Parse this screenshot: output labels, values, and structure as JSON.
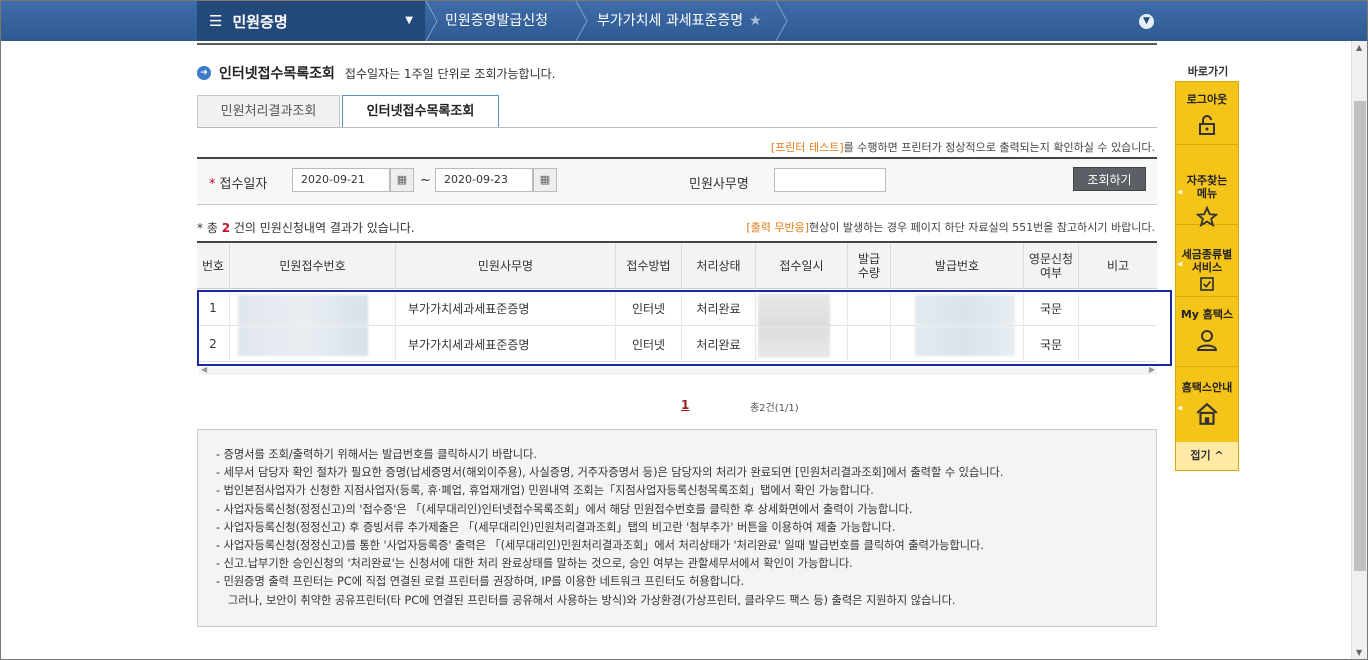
{
  "header": {
    "menu_title": "민원증명",
    "breadcrumb1": "민원증명발급신청",
    "breadcrumb2": "부가가치세 과세표준증명"
  },
  "page": {
    "title": "인터넷접수목록조회",
    "description": "접수일자는 1주일 단위로 조회가능합니다."
  },
  "tabs": [
    {
      "label": "민원처리결과조회",
      "active": false
    },
    {
      "label": "인터넷접수목록조회",
      "active": true
    }
  ],
  "notices": {
    "printer_link": "[프린터 테스트]",
    "printer_text": "를 수행하면 프린터가 정상적으로 출력되는지 확인하실 수 있습니다.",
    "output_link": "[출력 무반응]",
    "output_text": "현상이 발생하는 경우 페이지 하단 자료실의 551번을 참고하시기 바랍니다."
  },
  "search": {
    "date_label": "접수일자",
    "date_from": "2020-09-21",
    "date_to": "2020-09-23",
    "tilde": "~",
    "office_label": "민원사무명",
    "office_value": "",
    "button": "조회하기"
  },
  "summary": {
    "prefix": "* 총",
    "count": "2",
    "suffix": "건의 민원신청내역 결과가 있습니다."
  },
  "table": {
    "headers": [
      "번호",
      "민원접수번호",
      "민원사무명",
      "접수방법",
      "처리상태",
      "접수일시",
      "발급\n수량",
      "발급번호",
      "영문신청\n여부",
      "비고"
    ],
    "rows": [
      {
        "no": "1",
        "office": "부가가치세과세표준증명",
        "method": "인터넷",
        "status": "처리완료",
        "english": "국문"
      },
      {
        "no": "2",
        "office": "부가가치세과세표준증명",
        "method": "인터넷",
        "status": "처리완료",
        "english": "국문"
      }
    ]
  },
  "pagination": {
    "current": "1",
    "info": "총2건(1/1)"
  },
  "info_lines": [
    "- 증명서를 조회/출력하기 위해서는 발급번호를 클릭하시기 바랍니다.",
    "- 세무서 담당자 확인 절차가 필요한 증명(납세증명서(해외이주용), 사실증명, 거주자증명서 등)은 담당자의 처리가 완료되면 [민원처리결과조회]에서 출력할 수 있습니다.",
    "- 법인본점사업자가 신청한 지점사업자(등록, 휴·폐업, 휴업재개업) 민원내역 조회는「지점사업자등록신청목록조회」탭에서 확인 가능합니다.",
    "- 사업자등록신청(정정신고)의 '접수증'은 「(세무대리인)인터넷접수목록조회」에서 해당 민원접수번호를 클릭한 후 상세화면에서 출력이 가능합니다.",
    "- 사업자등록신청(정정신고) 후 증빙서류 추가제출은 「(세무대리인)민원처리결과조회」탭의 비고란 '첨부추가' 버튼을 이용하여 제출 가능합니다.",
    "- 사업자등록신청(정정신고)를 통한 '사업자등록증' 출력은 「(세무대리인)민원처리결과조회」에서 처리상태가 '처리완료' 일때 발급번호를 클릭하여 출력가능합니다.",
    "- 신고.납부기한 승인신청의 '처리완료'는 신청서에 대한 처리 완료상태를 말하는 것으로, 승인 여부는 관할세무서에서 확인이 가능합니다.",
    "- 민원증명 출력 프린터는 PC에 직접 연결된 로컬 프린터를 권장하며, IP를 이용한 네트워크 프린터도 허용합니다.",
    "그러나, 보안이 취약한 공유프린터(타 PC에 연결된 프린터를 공유해서 사용하는 방식)와 가상환경(가상프린터, 클라우드 팩스 등) 출력은 지원하지 않습니다."
  ],
  "quick_menu": {
    "title": "바로가기",
    "items": [
      {
        "label": "로그아웃",
        "icon": "unlock-icon"
      },
      {
        "label": "자주찾는\n메뉴",
        "icon": "star-icon"
      },
      {
        "label": "세금종류별\n서비스",
        "icon": "checklist-icon"
      },
      {
        "label": "My 홈택스",
        "icon": "person-icon"
      },
      {
        "label": "홈택스안내",
        "icon": "home-icon"
      }
    ],
    "fold": "접기 ^"
  },
  "colors": {
    "topbar": "#2f5a93",
    "accent_orange": "#e07b15",
    "quick_yellow": "#f5c419",
    "highlight_border": "#1a25a8"
  }
}
